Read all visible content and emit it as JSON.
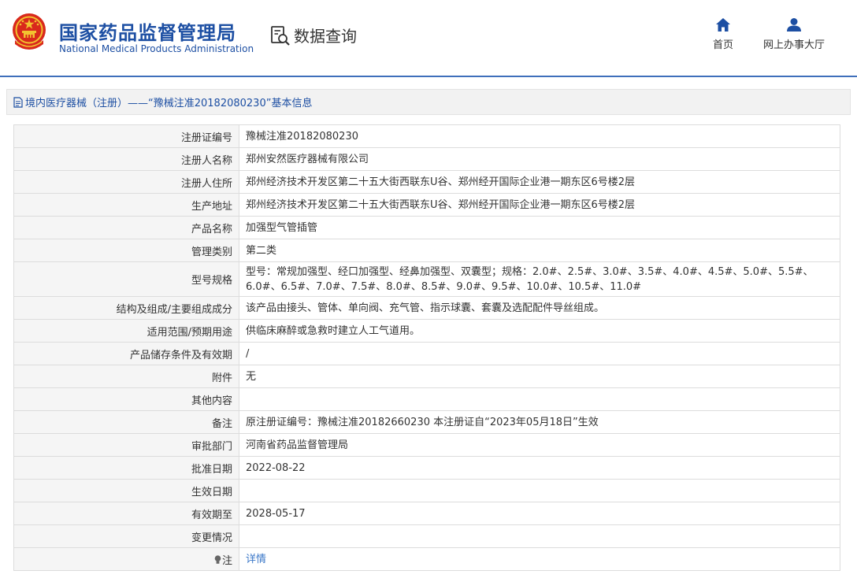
{
  "header": {
    "org_name_cn": "国家药品监督管理局",
    "org_name_en": "National Medical Products Administration",
    "section_title": "数据查询",
    "nav": [
      {
        "label": "首页",
        "icon": "home-icon"
      },
      {
        "label": "网上办事大厅",
        "icon": "user-icon"
      }
    ],
    "accent_color": "#1d4fa3"
  },
  "breadcrumb": {
    "text": "境内医疗器械（注册）——“豫械注准20182080230”基本信息",
    "icon": "document-icon"
  },
  "table": {
    "rows": [
      {
        "key": "注册证编号",
        "value": "豫械注准20182080230"
      },
      {
        "key": "注册人名称",
        "value": "郑州安然医疗器械有限公司"
      },
      {
        "key": "注册人住所",
        "value": "郑州经济技术开发区第二十五大街西联东U谷、郑州经开国际企业港一期东区6号楼2层"
      },
      {
        "key": "生产地址",
        "value": "郑州经济技术开发区第二十五大街西联东U谷、郑州经开国际企业港一期东区6号楼2层"
      },
      {
        "key": "产品名称",
        "value": "加强型气管插管"
      },
      {
        "key": "管理类别",
        "value": "第二类"
      },
      {
        "key": "型号规格",
        "value": "型号：常规加强型、经口加强型、经鼻加强型、双囊型；规格：2.0#、2.5#、3.0#、3.5#、4.0#、4.5#、5.0#、5.5#、6.0#、6.5#、7.0#、7.5#、8.0#、8.5#、9.0#、9.5#、10.0#、10.5#、11.0#"
      },
      {
        "key": "结构及组成/主要组成成分",
        "value": "该产品由接头、管体、单向阀、充气管、指示球囊、套囊及选配配件导丝组成。"
      },
      {
        "key": "适用范围/预期用途",
        "value": "供临床麻醉或急救时建立人工气道用。"
      },
      {
        "key": "产品储存条件及有效期",
        "value": "/"
      },
      {
        "key": "附件",
        "value": "无"
      },
      {
        "key": "其他内容",
        "value": ""
      },
      {
        "key": "备注",
        "value": "原注册证编号：豫械注准20182660230 本注册证自“2023年05月18日”生效"
      },
      {
        "key": "审批部门",
        "value": "河南省药品监督管理局"
      },
      {
        "key": "批准日期",
        "value": "2022-08-22"
      },
      {
        "key": "生效日期",
        "value": ""
      },
      {
        "key": "有效期至",
        "value": "2028-05-17"
      },
      {
        "key": "变更情况",
        "value": ""
      },
      {
        "key": "注",
        "value": "详情"
      }
    ]
  }
}
